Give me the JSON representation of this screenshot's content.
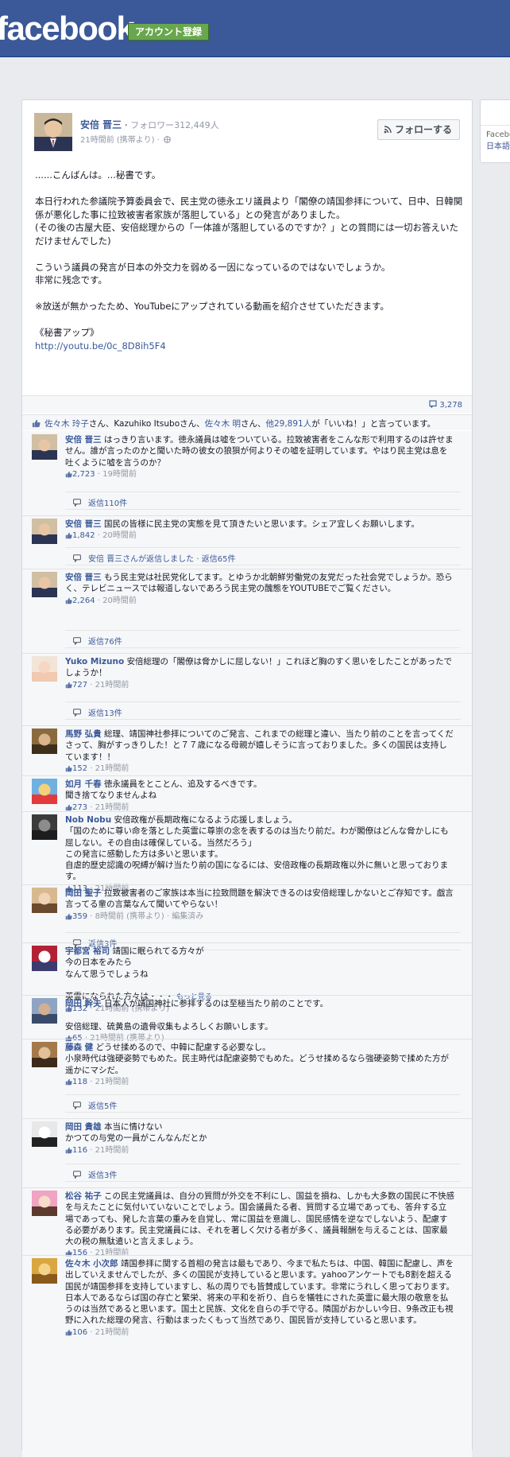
{
  "header": {
    "logo": "facebook",
    "signup_label": "アカウント登録"
  },
  "side": {
    "title": "Facebo",
    "link": "日本語"
  },
  "post": {
    "author": "安倍 晋三",
    "followers": "・フォロワー312,449人",
    "time": "21時間前 (携帯より) ·",
    "follow_label": "フォローする",
    "body": [
      "......こんばんは。...秘書です。",
      "",
      "本日行われた参議院予算委員会で、民主党の徳永エリ議員より「閣僚の靖国参拝について、日中、日韓関係が悪化した事に拉致被害者家族が落胆している」との発言がありました。",
      "(その後の古屋大臣、安倍総理からの「一体誰が落胆しているのですか？」との質問には一切お答えいただけませんでした)",
      "",
      "こういう議員の発言が日本の外交力を弱める一因になっているのではないでしょうか。",
      "非常に残念です。",
      "",
      "※放送が無かったため、YouTubeにアップされている動画を紹介させていただきます。",
      "",
      "《秘書アップ》"
    ],
    "link": "http://youtu.be/0c_8D8ih5F4",
    "share_count": "3,278",
    "likes": {
      "names": [
        "佐々木 玲子",
        "Kazuhiko Itsubo",
        "佐々木 明"
      ],
      "sep1": "さん、",
      "sep2": "さん、",
      "sep3": "さん、",
      "others": "他29,891人",
      "suffix": "が「いいね！」と言っています。"
    }
  },
  "comments": [
    {
      "name": "安倍 晋三",
      "text": "はっきり言います。徳永議員は嘘をついている。拉致被害者をこんな形で利用するのは許せません。誰が言ったのかと聞いた時の彼女の狼狽が何よりその嘘を証明しています。やはり民主党は息を吐くように嘘を言うのか？",
      "likes": "2,723",
      "meta": " · 19時間前",
      "replies": "返信110件"
    },
    {
      "name": "安倍 晋三",
      "text": "国民の皆様に民主党の実態を見て頂きたいと思います。シェア宜しくお願いします。",
      "likes": "1,842",
      "meta": " · 20時間前",
      "replies": "安倍 晋三さんが返信しました · 返信65件"
    },
    {
      "name": "安倍 晋三",
      "text": "もう民主党は社民党化してます。とゆうか北朝鮮労働党の友党だった社会党でしょうか。恐らく、テレビニュースでは報道しないであろう民主党の醜態をYOUTUBEでご覧ください。",
      "likes": "2,264",
      "meta": " · 20時間前",
      "replies": "返信76件"
    },
    {
      "name": "Yuko Mizuno",
      "text": "安倍総理の「閣僚は脅かしに屈しない！」これほど胸のすく思いをしたことがあったでしょうか！",
      "likes": "727",
      "meta": " · 21時間前",
      "replies": "返信13件"
    },
    {
      "name": "馬野 弘貴",
      "text": "総理、靖国神社参拝についてのご発言、これまでの総理と違い、当たり前のことを言ってくださって、胸がすっきりした！と７７歳になる母親が嬉しそうに言っておりました。多くの国民は支持しています！！",
      "likes": "152",
      "meta": " · 21時間前"
    },
    {
      "name": "如月 千春",
      "text": "徳永議員をとことん、追及するべきです。\n聞き捨てなりませんよね",
      "likes": "273",
      "meta": " · 21時間前"
    },
    {
      "name": "Nob Nobu",
      "text": "安倍政権が長期政権になるよう応援しましょう。\n「国のために尊い命を落とした英霊に尊崇の念を表するのは当たり前だ。わが閣僚はどんな脅かしにも屈しない。その自由は確保している。当然だろう」\nこの発言に感動した方は多いと思います。\n自虐的歴史認識の呪縛が解け当たり前の国になるには、安倍政権の長期政権以外に無いと思っております。",
      "likes": "113",
      "meta": " · 21時間前"
    },
    {
      "name": "岡田 聖子",
      "text": "拉致被害者のご家族は本当に拉致問題を解決できるのは安倍総理しかないとご存知です。戯言言ってる輩の言葉なんて聞いてやらない！",
      "likes": "359",
      "meta": " · 8時間前 (携帯より) · 編集済み",
      "replies": "返信3件"
    },
    {
      "name": "宇都宮 裕司",
      "text": "靖国に眠られてる方々が\n今の日本をみたら\nなんて思うでしょうね\n\n英霊になられた方々は・・・",
      "more": "もっと見る",
      "likes": "132",
      "meta": " · 21時間前 (携帯より)"
    },
    {
      "name": "岡田 幹夫",
      "text": "日本人が靖国神社に参拝するのは至極当たり前のことです。\n\n安倍総理、硫黄島の遺骨収集もよろしくお願いします。",
      "likes": "65",
      "meta": " · 21時間前 (携帯より)"
    },
    {
      "name": "藤森 健",
      "text": "どうせ揉めるので、中韓に配慮する必要なし。\n小泉時代は強硬姿勢でもめた。民主時代は配慮姿勢でもめた。どうせ揉めるなら強硬姿勢で揉めた方が遥かにマシだ。",
      "likes": "118",
      "meta": " · 21時間前",
      "replies": "返信5件"
    },
    {
      "name": "岡田 貴雄",
      "text": "本当に情けない\nかつての与党の一員がこんなんだとか",
      "likes": "116",
      "meta": " · 21時間前",
      "replies": "返信3件"
    },
    {
      "name": "松谷 祐子",
      "text": "この民主党議員は、自分の質問が外交を不利にし、国益を損ね、しかも大多数の国民に不快感を与えたことに気付いていないことでしょう。国会議員たる者、質問する立場であっても、答弁する立場であっても、発した言葉の重みを自覚し、常に国益を意識し、国民感情を逆なでしないよう、配慮する必要があります。民主党議員には、それを著しく欠ける者が多く、議員報酬を与えることは、国家最大の税の無駄遣いと言えましょう。",
      "likes": "156",
      "meta": " · 21時間前"
    },
    {
      "name": "佐々木 小次郎",
      "text": "靖国参拝に関する首相の発言は最もであり、今まで私たちは、中国、韓国に配慮し、声を出していえませんでしたが、多くの国民が支持していると思います。yahooアンケートでも8割を超える国民が靖国参拝を支持していますし、私の周りでも皆賛成しています。非常にうれしく思っております。日本人であるならば国の存亡と繁栄、将来の平和を祈り、自らを犠牲にされた英霊に最大限の敬意を払うのは当然であると思います。国土と民族、文化を自らの手で守る。隣国がおかしい今日、9条改正も視野に入れた総理の発言、行動はまったくもって当然であり、国民皆が支持していると思います。",
      "likes": "106",
      "meta": " · 21時間前"
    }
  ],
  "colors": {
    "brand": "#3b5998",
    "signup": "#69a74e",
    "meta": "#9197a3"
  }
}
